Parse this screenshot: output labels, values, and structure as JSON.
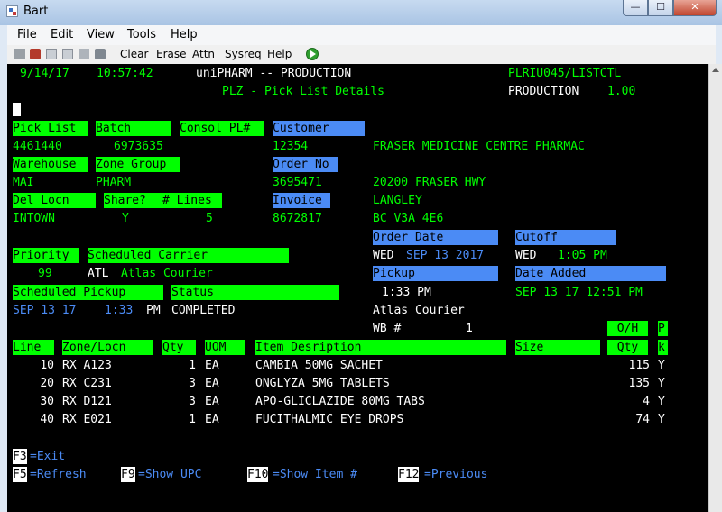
{
  "window": {
    "title": "Bart",
    "min_symbol": "—",
    "max_symbol": "☐",
    "close_symbol": "✕"
  },
  "menu": [
    "File",
    "Edit",
    "View",
    "Tools",
    "Help"
  ],
  "toolbar": [
    "Clear",
    "Erase",
    "Attn",
    "Sysreq",
    "Help"
  ],
  "header": {
    "date": "9/14/17",
    "time": "10:57:42",
    "system": "uniPHARM -- PRODUCTION",
    "program": "PLRIU045/LISTCTL",
    "screen_title": "PLZ - Pick List Details",
    "env": "PRODUCTION",
    "version": "1.00"
  },
  "labels": {
    "pick_list": "Pick List",
    "batch": "Batch",
    "consol": "Consol PL#",
    "customer": "Customer",
    "warehouse": "Warehouse",
    "zone_group": "Zone Group",
    "order_no": "Order No",
    "del_locn": "Del Locn",
    "share": "Share?",
    "lines": "# Lines",
    "invoice": "Invoice",
    "order_date": "Order Date",
    "cutoff": "Cutoff",
    "priority": "Priority",
    "sched_carrier": "Scheduled Carrier",
    "pickup": "Pickup",
    "date_added": "Date Added",
    "sched_pickup": "Scheduled Pickup",
    "status": "Status",
    "wb": "WB #"
  },
  "values": {
    "pick_list": "4461440",
    "batch": "6973635",
    "customer_no": "12354",
    "customer_name": "FRASER MEDICINE CENTRE PHARMAC",
    "warehouse": "MAI",
    "zone_group": "PHARM",
    "order_no": "3695471",
    "address1": "20200 FRASER HWY",
    "del_locn": "INTOWN",
    "share": "Y",
    "lines": "5",
    "city": "LANGLEY",
    "invoice": "8672817",
    "prov_postal": "BC V3A 4E6",
    "order_day": "WED",
    "order_date": "SEP 13 2017",
    "cutoff_day": "WED",
    "cutoff_time": "1:05 PM",
    "priority": "99",
    "carrier_code": "ATL",
    "carrier_name": "Atlas Courier",
    "pickup_time": "1:33 PM",
    "date_added": "SEP 13 17 12:51 PM",
    "sched_pickup_date": "SEP 13 17",
    "sched_pickup_time": "1:33",
    "sched_pickup_ampm": "PM",
    "status": "COMPLETED",
    "pickup_carrier": "Atlas Courier",
    "wb": "1"
  },
  "table": {
    "headers": {
      "line": "Line",
      "zone": "Zone/Locn",
      "qty": "Qty",
      "uom": "UOM",
      "item": "Item Desription",
      "size": "Size",
      "oh_top": "O/H",
      "oh_bottom": "Qty",
      "pk_top": "P",
      "pk_bottom": "k"
    },
    "rows": [
      {
        "line": "10",
        "zone": "RX A123",
        "qty": "1",
        "uom": "EA",
        "item": "CAMBIA 50MG SACHET",
        "oh": "115",
        "pk": "Y"
      },
      {
        "line": "20",
        "zone": "RX C231",
        "qty": "3",
        "uom": "EA",
        "item": "ONGLYZA 5MG TABLETS",
        "oh": "135",
        "pk": "Y"
      },
      {
        "line": "30",
        "zone": "RX D121",
        "qty": "3",
        "uom": "EA",
        "item": "APO-GLICLAZIDE 80MG TABS",
        "oh": "4",
        "pk": "Y"
      },
      {
        "line": "40",
        "zone": "RX E021",
        "qty": "1",
        "uom": "EA",
        "item": "FUCITHALMIC EYE DROPS",
        "oh": "74",
        "pk": "Y"
      }
    ]
  },
  "fkeys": [
    {
      "key": "F3",
      "label": "=Exit"
    },
    {
      "key": "F5",
      "label": "=Refresh"
    },
    {
      "key": "F9",
      "label": "=Show UPC"
    },
    {
      "key": "F10",
      "label": "=Show Item #"
    },
    {
      "key": "F12",
      "label": "=Previous"
    }
  ],
  "colors": {
    "screen_bg": "#000000",
    "green": "#00ff00",
    "blue": "#4b8bf5",
    "white": "#ffffff"
  }
}
